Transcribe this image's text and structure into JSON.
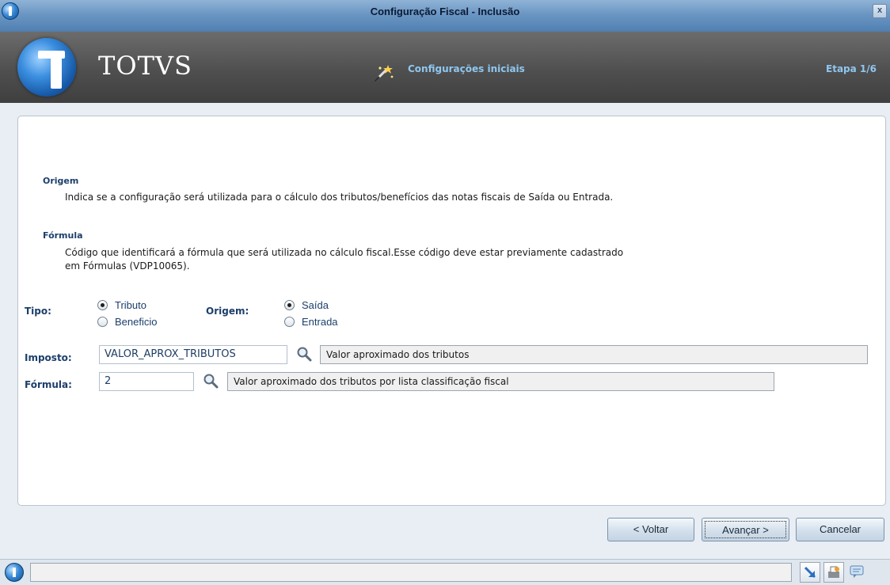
{
  "window": {
    "title": "Configuração Fiscal - Inclusão",
    "close_label": "x"
  },
  "header": {
    "logo_text": "TOTVS",
    "step_name": "Configurações iniciais",
    "step_count": "Etapa 1/6",
    "wand_icon": "magic-wand-icon"
  },
  "help": {
    "origem_title": "Origem",
    "origem_text": "Indica se a configuração será utilizada para o cálculo dos tributos/benefícios das notas fiscais de Saída ou Entrada.",
    "formula_title": "Fórmula",
    "formula_text_1": "Código que identificará a fórmula que será utilizada no cálculo fiscal.Esse código deve estar previamente cadastrado",
    "formula_text_2": "em Fórmulas (VDP10065)."
  },
  "form": {
    "tipo_label": "Tipo:",
    "tipo_options": [
      {
        "label": "Tributo",
        "selected": true
      },
      {
        "label": "Beneficio",
        "selected": false
      }
    ],
    "origem_label": "Origem:",
    "origem_options": [
      {
        "label": "Saída",
        "selected": true
      },
      {
        "label": "Entrada",
        "selected": false
      }
    ],
    "imposto_label": "Imposto:",
    "imposto_value": "VALOR_APROX_TRIBUTOS",
    "imposto_description": "Valor aproximado dos tributos",
    "formula_label": "Fórmula:",
    "formula_value": "2",
    "formula_description": "Valor aproximado dos tributos por lista classificação fiscal"
  },
  "buttons": {
    "back": "< Voltar",
    "next": "Avançar >",
    "cancel": "Cancelar"
  },
  "colors": {
    "accent_text": "#1c3f6b",
    "header_step_text": "#8fc7f0"
  }
}
